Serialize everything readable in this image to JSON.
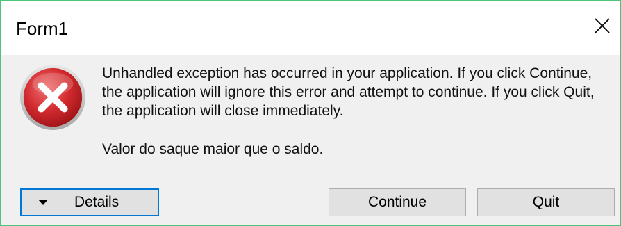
{
  "window": {
    "title": "Form1",
    "close_glyph": "✕"
  },
  "icon": {
    "name": "error-icon",
    "color": "#c8282c"
  },
  "message": {
    "text": "Unhandled exception has occurred in your application. If you click Continue, the application will ignore this error and attempt to continue. If you click Quit, the application will close immediately.",
    "detail": "Valor do saque maior que o saldo."
  },
  "buttons": {
    "details_label": "Details",
    "continue_label": "Continue",
    "quit_label": "Quit"
  },
  "colors": {
    "focus_border": "#0078d7",
    "window_border": "#4ec47a",
    "button_face": "#e1e1e1"
  }
}
